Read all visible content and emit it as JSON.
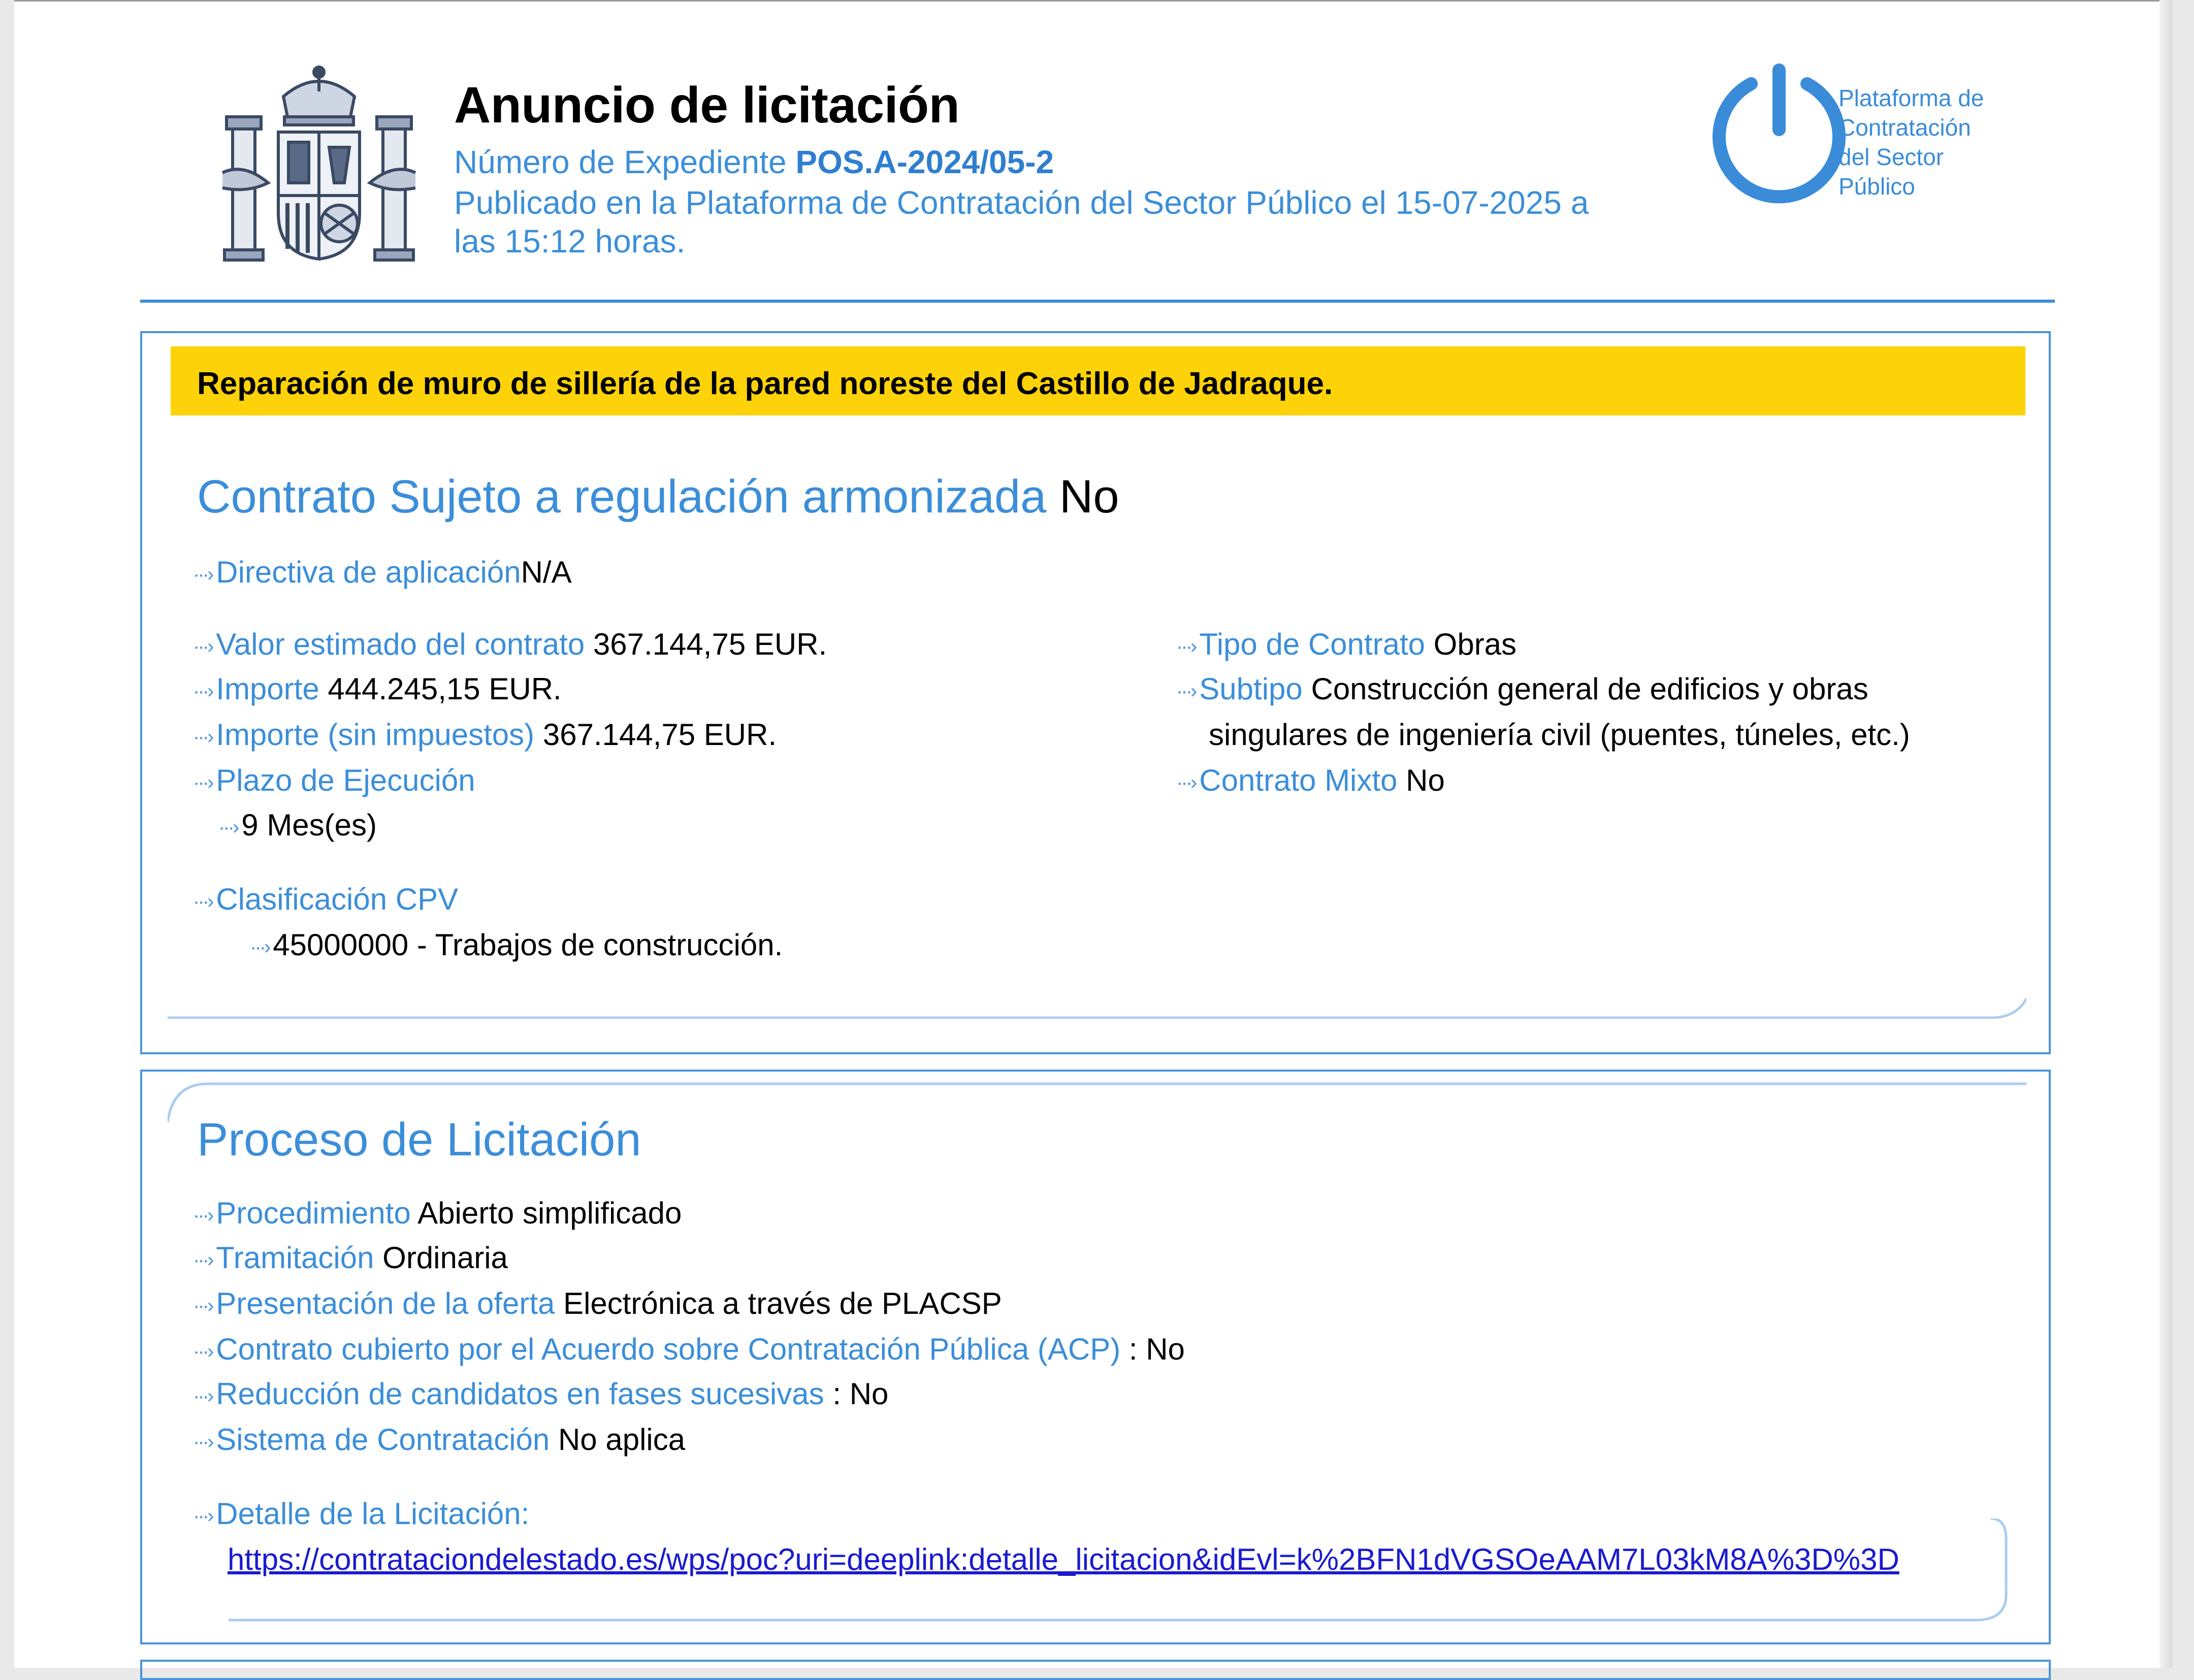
{
  "header": {
    "title": "Anuncio de licitación",
    "expediente_label": "Número de Expediente",
    "expediente_value": "POS.A-2024/05-2",
    "published_line1": "Publicado en la Plataforma de Contratación del Sector Público el 15-07-2025 a",
    "published_line2": "las 15:12 horas.",
    "logo_text": [
      "Plataforma de",
      "Contratación",
      "del Sector",
      "Público"
    ]
  },
  "contract": {
    "banner": "Reparación de muro de sillería de la pared noreste del Castillo de Jadraque.",
    "armonizada_label": "Contrato Sujeto a regulación armonizada",
    "armonizada_value": "No",
    "directiva_label": "Directiva de aplicación",
    "directiva_value": "N/A",
    "valor_label": "Valor estimado del contrato",
    "valor_value": "367.144,75 EUR.",
    "importe_label": "Importe",
    "importe_value": "444.245,15 EUR.",
    "importe_sin_label": "Importe (sin impuestos)",
    "importe_sin_value": "367.144,75 EUR.",
    "plazo_label": "Plazo de Ejecución",
    "plazo_value": "9 Mes(es)",
    "cpv_label": "Clasificación CPV",
    "cpv_value": "45000000 - Trabajos de construcción.",
    "tipo_label": "Tipo de Contrato",
    "tipo_value": "Obras",
    "subtipo_label": "Subtipo",
    "subtipo_value_1": "Construcción general de edificios y obras",
    "subtipo_value_2": "singulares de ingeniería civil (puentes, túneles, etc.)",
    "mixto_label": "Contrato Mixto",
    "mixto_value": "No"
  },
  "proceso": {
    "heading": "Proceso de Licitación",
    "procedimiento_label": "Procedimiento",
    "procedimiento_value": "Abierto simplificado",
    "tramitacion_label": "Tramitación",
    "tramitacion_value": "Ordinaria",
    "presentacion_label": "Presentación de la oferta",
    "presentacion_value": "Electrónica a través de PLACSP",
    "acp_label": "Contrato cubierto por el Acuerdo sobre Contratación Pública (ACP)",
    "acp_value": ": No",
    "reduccion_label": "Reducción de candidatos en fases sucesivas",
    "reduccion_value": ": No",
    "sistema_label": "Sistema de Contratación",
    "sistema_value": "No aplica",
    "detalle_label": "Detalle de la Licitación:",
    "detalle_url": "https://contrataciondelestado.es/wps/poc?uri=deeplink:detalle_licitacion&idEvl=k%2BFN1dVGSOeAAM7L03kM8A%3D%3D"
  },
  "colors": {
    "accent": "#3b8ed9",
    "banner": "#fdd209",
    "link": "#1a1ad0"
  }
}
